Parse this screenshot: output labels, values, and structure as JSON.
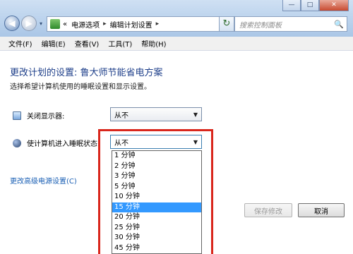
{
  "address": {
    "back_glyph": "◀",
    "fwd_glyph": "▶",
    "prefix": "«",
    "crumbs": [
      "电源选项",
      "编辑计划设置"
    ],
    "sep": "▸",
    "dropdown": "▾",
    "refresh": "↻"
  },
  "window": {
    "min": "—",
    "max": "□",
    "close": "✕"
  },
  "search": {
    "placeholder": "搜索控制面板",
    "icon": "🔍"
  },
  "menu": [
    "文件(F)",
    "编辑(E)",
    "查看(V)",
    "工具(T)",
    "帮助(H)"
  ],
  "content": {
    "heading": "更改计划的设置: 鲁大师节能省电方案",
    "subtitle": "选择希望计算机使用的睡眠设置和显示设置。",
    "display_off_label": "关闭显示器:",
    "display_off_value": "从不",
    "sleep_label": "使计算机进入睡眠状态:",
    "sleep_value": "从不",
    "advanced_link": "更改高级电源设置(C)",
    "save_button": "保存修改",
    "cancel_button": "取消",
    "arrow": "▼"
  },
  "dropdown_options": [
    "1 分钟",
    "2 分钟",
    "3 分钟",
    "5 分钟",
    "10 分钟",
    "15 分钟",
    "20 分钟",
    "25 分钟",
    "30 分钟",
    "45 分钟"
  ],
  "colors": {
    "heading": "#1e3f8a",
    "highlight": "#3399ff",
    "annotation": "#d9261c"
  }
}
